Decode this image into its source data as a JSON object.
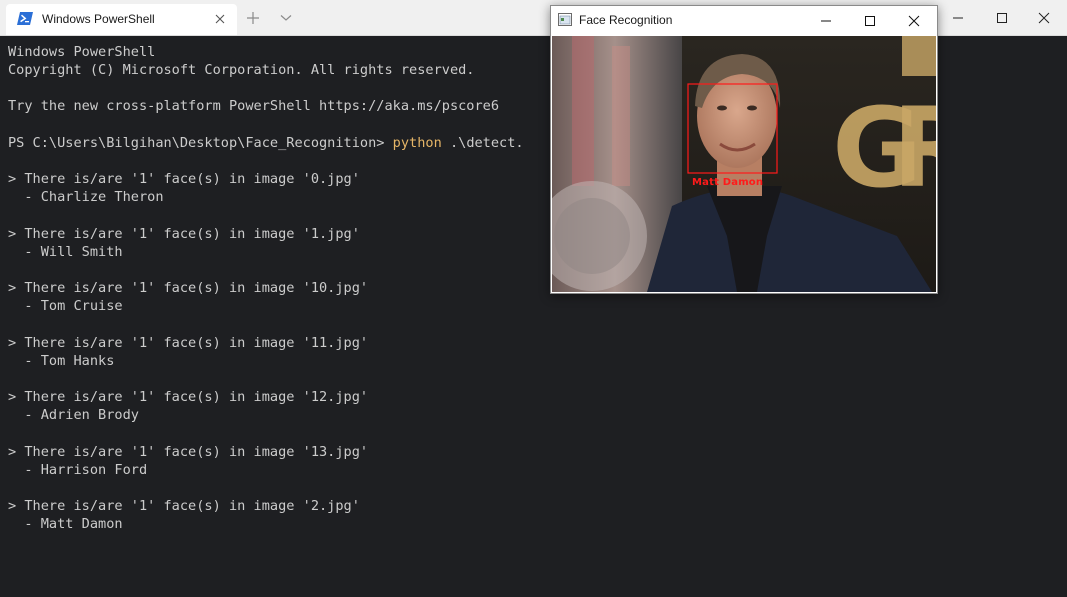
{
  "terminal_tab": {
    "title": "Windows PowerShell",
    "icon": "powershell-icon"
  },
  "terminal": {
    "header_line1": "Windows PowerShell",
    "header_line2": "Copyright (C) Microsoft Corporation. All rights reserved.",
    "try_line": "Try the new cross-platform PowerShell https://aka.ms/pscore6",
    "prompt": "PS C:\\Users\\Bilgihan\\Desktop\\Face_Recognition> ",
    "command": "python",
    "command_args": " .\\detect.",
    "results": [
      {
        "line": "> There is/are '1' face(s) in image '0.jpg'",
        "name": "  - Charlize Theron"
      },
      {
        "line": "> There is/are '1' face(s) in image '1.jpg'",
        "name": "  - Will Smith"
      },
      {
        "line": "> There is/are '1' face(s) in image '10.jpg'",
        "name": "  - Tom Cruise"
      },
      {
        "line": "> There is/are '1' face(s) in image '11.jpg'",
        "name": "  - Tom Hanks"
      },
      {
        "line": "> There is/are '1' face(s) in image '12.jpg'",
        "name": "  - Adrien Brody"
      },
      {
        "line": "> There is/are '1' face(s) in image '13.jpg'",
        "name": "  - Harrison Ford"
      },
      {
        "line": "> There is/are '1' face(s) in image '2.jpg'",
        "name": "  - Matt Damon"
      }
    ]
  },
  "face_window": {
    "title": "Face Recognition",
    "detected_label": "Matt Damon",
    "box_color": "#ff1a1a"
  },
  "colors": {
    "terminal_bg": "#1e1f22",
    "terminal_text": "#cccccc",
    "command_color": "#e5b567"
  }
}
